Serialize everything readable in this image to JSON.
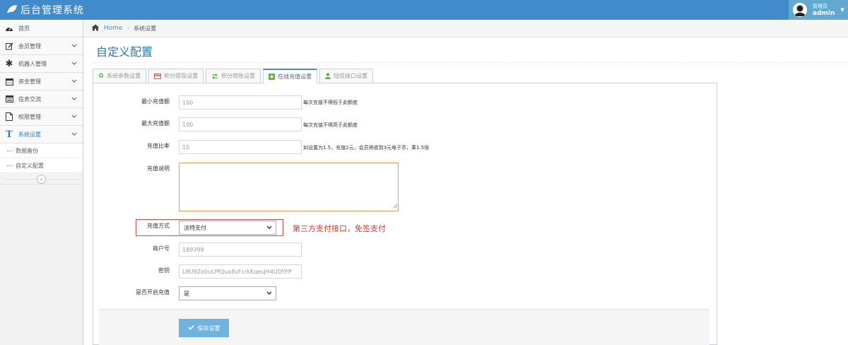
{
  "app": {
    "title": "后台管理系统"
  },
  "user": {
    "role": "管理员",
    "name": "admin"
  },
  "sidebar": {
    "items": [
      {
        "label": "首页",
        "icon": "dashboard-icon"
      },
      {
        "label": "会员管理",
        "icon": "edit-icon"
      },
      {
        "label": "机器人管理",
        "icon": "asterisk-icon"
      },
      {
        "label": "资金管理",
        "icon": "calendar-icon"
      },
      {
        "label": "信息交流",
        "icon": "list-icon"
      },
      {
        "label": "权限管理",
        "icon": "file-icon"
      },
      {
        "label": "系统设置",
        "icon": "text-icon"
      }
    ],
    "subitems": [
      {
        "label": "数据备份"
      },
      {
        "label": "自定义配置"
      }
    ],
    "collapse_glyph": "«"
  },
  "breadcrumb": {
    "home": "Home",
    "current": "系统设置"
  },
  "page": {
    "title": "自定义配置"
  },
  "tabs": [
    {
      "label": "系统参数设置"
    },
    {
      "label": "积分提现设置"
    },
    {
      "label": "积分转账设置"
    },
    {
      "label": "在线充值设置"
    },
    {
      "label": "短信接口设置"
    }
  ],
  "form": {
    "min": {
      "label": "最小充值额",
      "value": "100",
      "help": "每次充值不得低于此额度"
    },
    "max": {
      "label": "最大充值额",
      "value": "100",
      "help": "每次充值不得高于此额度"
    },
    "ratio": {
      "label": "充值比率",
      "value": "10",
      "help": "如设置为1.5，充值2元，会员将收到3元电子币，乘1.5倍"
    },
    "desc": {
      "label": "充值说明"
    },
    "method": {
      "label": "充值方式",
      "value": "派特支付"
    },
    "merchant": {
      "label": "商户号",
      "value": "189399"
    },
    "key": {
      "label": "密钥",
      "value": "L8U9Zo0uLPfQux8vFcrkKqesJH4UDYFP"
    },
    "enable": {
      "label": "是否开启充值",
      "value": "是"
    },
    "save": "保存设置"
  },
  "annotation": "第三方支付接口，免签支付",
  "colors": {
    "navbar": "#428bca",
    "accent": "#2679b5",
    "annotation": "#d9362e",
    "button": "#6fb3e0"
  }
}
